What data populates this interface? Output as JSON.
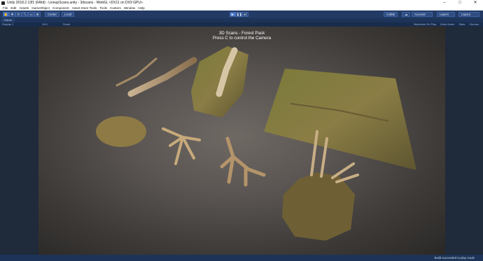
{
  "window": {
    "title": "Unity 2018.2.13f1 (64bit) - LineupScans.unity - 3dscans - WebGL <DX11 on DX9 GPU>",
    "controls": [
      "–",
      "□",
      "✕"
    ]
  },
  "menu": [
    "File",
    "Edit",
    "Assets",
    "GameObject",
    "Component",
    "Asset Store Tools",
    "Tools",
    "Custom",
    "Window",
    "Help"
  ],
  "toolbar": {
    "center_label": "Center",
    "local_label": "Local",
    "collab_label": "Collab",
    "account_label": "Account",
    "layers_label": "Layers",
    "layout_label": "Layout"
  },
  "tabs": {
    "game": "Game"
  },
  "game_bar": {
    "display": "Display 1",
    "aspect": "16:9",
    "scale": "Scale",
    "right_items": [
      "Maximize On Play",
      "Mute Audio",
      "Stats",
      "Gizmos"
    ]
  },
  "overlay": {
    "line1": "3D Scans - Forest Pack",
    "line2": "Press C to control the Camera"
  },
  "status": {
    "message": "Build succeeded to play mode"
  },
  "colors": {
    "chrome": "#223a64",
    "highlight": "#4a78c8",
    "viewport": "#5a5552"
  }
}
